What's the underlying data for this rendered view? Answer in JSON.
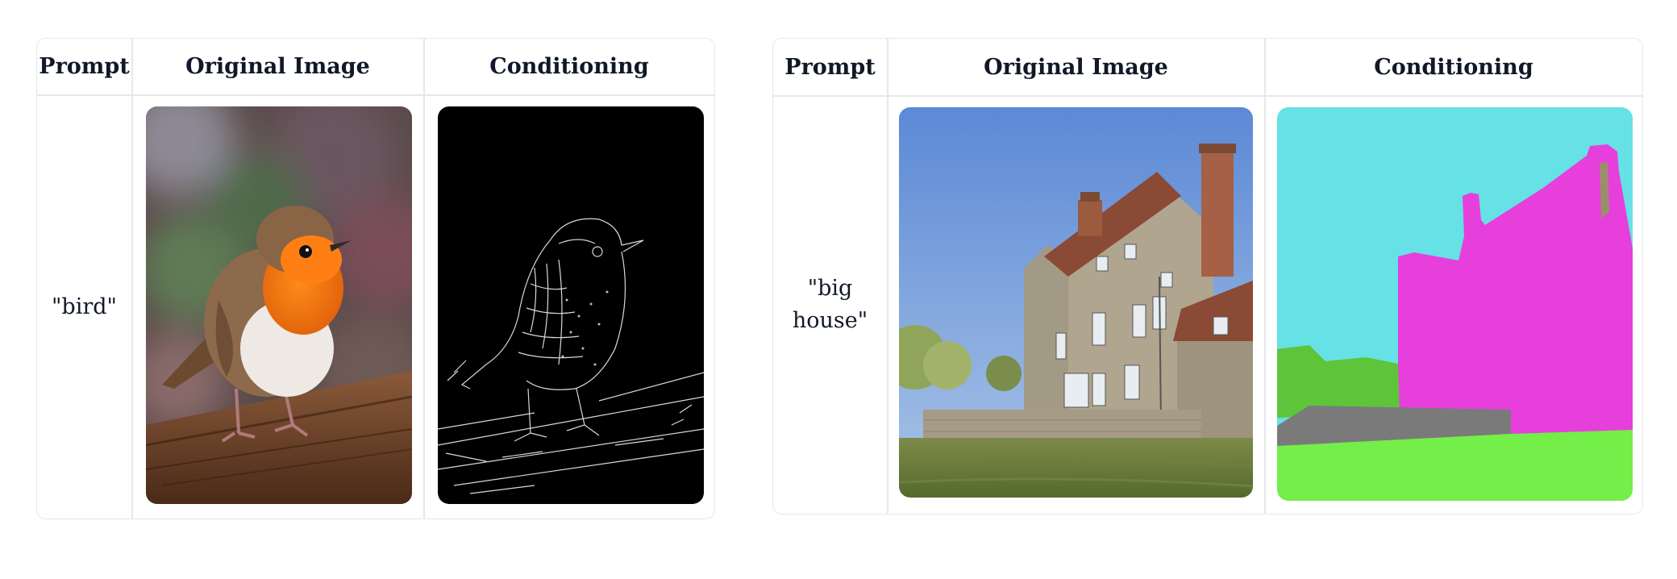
{
  "tables": [
    {
      "headers": [
        "Prompt",
        "Original Image",
        "Conditioning"
      ],
      "prompt": "\"bird\"",
      "original_image": "photo-robin-on-wooden-rail",
      "conditioning_image": "canny-edge-map-robin"
    },
    {
      "headers": [
        "Prompt",
        "Original Image",
        "Conditioning"
      ],
      "prompt": "\"big house\"",
      "original_image": "photo-stone-house-with-lawn",
      "conditioning_image": "segmentation-map-house"
    }
  ],
  "colors": {
    "border": "#e5e7eb",
    "seg_sky": "#66e1e5",
    "seg_building": "#e63fdb",
    "seg_grass": "#74ee48",
    "seg_wall": "#7a7a7a",
    "seg_tree": "#5ec43a"
  }
}
